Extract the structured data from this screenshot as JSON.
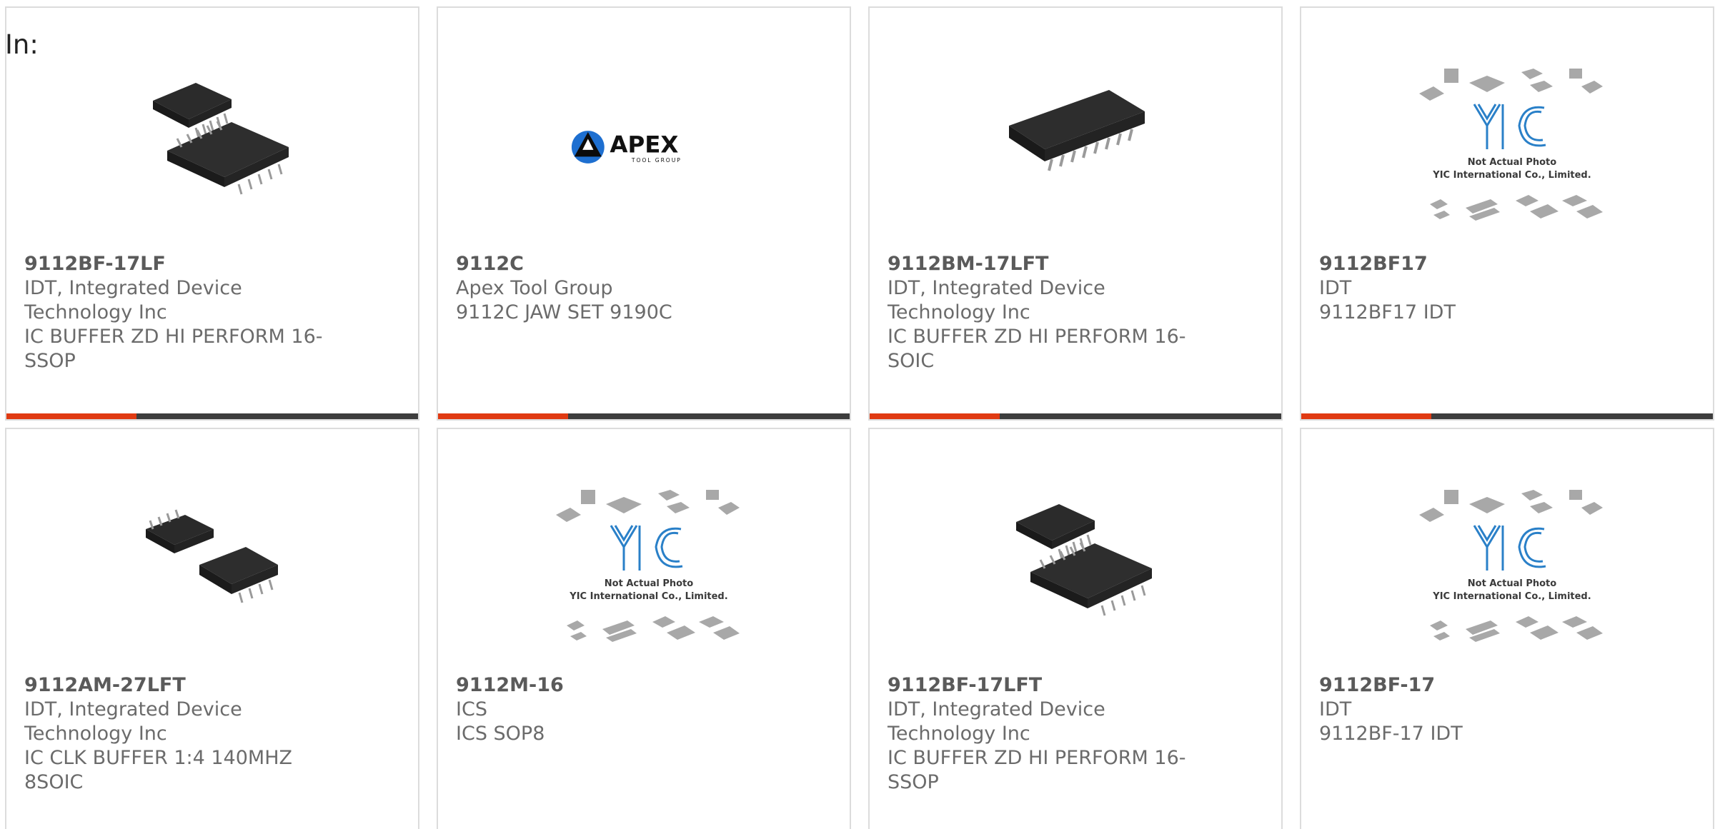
{
  "header": {
    "label": "In:"
  },
  "colors": {
    "accent": "#e03a12",
    "bar": "#3d3d3d",
    "border": "#dcdcdc",
    "text": "#6b6b6b"
  },
  "products": [
    {
      "part": "9112BF-17LF",
      "manufacturer": "IDT, Integrated Device Technology Inc",
      "description": "IC BUFFER ZD HI PERFORM 16-SSOP",
      "image": "chip-ssop16-pair"
    },
    {
      "part": "9112C",
      "manufacturer": "Apex Tool Group",
      "description": "9112C JAW SET 9190C",
      "image": "apex-logo",
      "logo_text": "APEX",
      "logo_subtext": "TOOL GROUP"
    },
    {
      "part": "9112BM-17LFT",
      "manufacturer": "IDT, Integrated Device Technology Inc",
      "description": "IC BUFFER ZD HI PERFORM 16-SOIC",
      "image": "chip-soic16"
    },
    {
      "part": "9112BF17",
      "manufacturer": "IDT",
      "description": "9112BF17 IDT",
      "image": "yic-placeholder",
      "placeholder_line1": "Not Actual Photo",
      "placeholder_line2": "YIC International Co., Limited."
    },
    {
      "part": "9112AM-27LFT",
      "manufacturer": "IDT, Integrated Device Technology Inc",
      "description": "IC CLK BUFFER 1:4 140MHZ 8SOIC",
      "image": "chip-soic8-pair"
    },
    {
      "part": "9112M-16",
      "manufacturer": "ICS",
      "description": "ICS SOP8",
      "image": "yic-placeholder",
      "placeholder_line1": "Not Actual Photo",
      "placeholder_line2": "YIC International Co., Limited."
    },
    {
      "part": "9112BF-17LFT",
      "manufacturer": "IDT, Integrated Device Technology Inc",
      "description": "IC BUFFER ZD HI PERFORM 16-SSOP",
      "image": "chip-ssop16-pair"
    },
    {
      "part": "9112BF-17",
      "manufacturer": "IDT",
      "description": "9112BF-17 IDT",
      "image": "yic-placeholder",
      "placeholder_line1": "Not Actual Photo",
      "placeholder_line2": "YIC International Co., Limited."
    }
  ]
}
